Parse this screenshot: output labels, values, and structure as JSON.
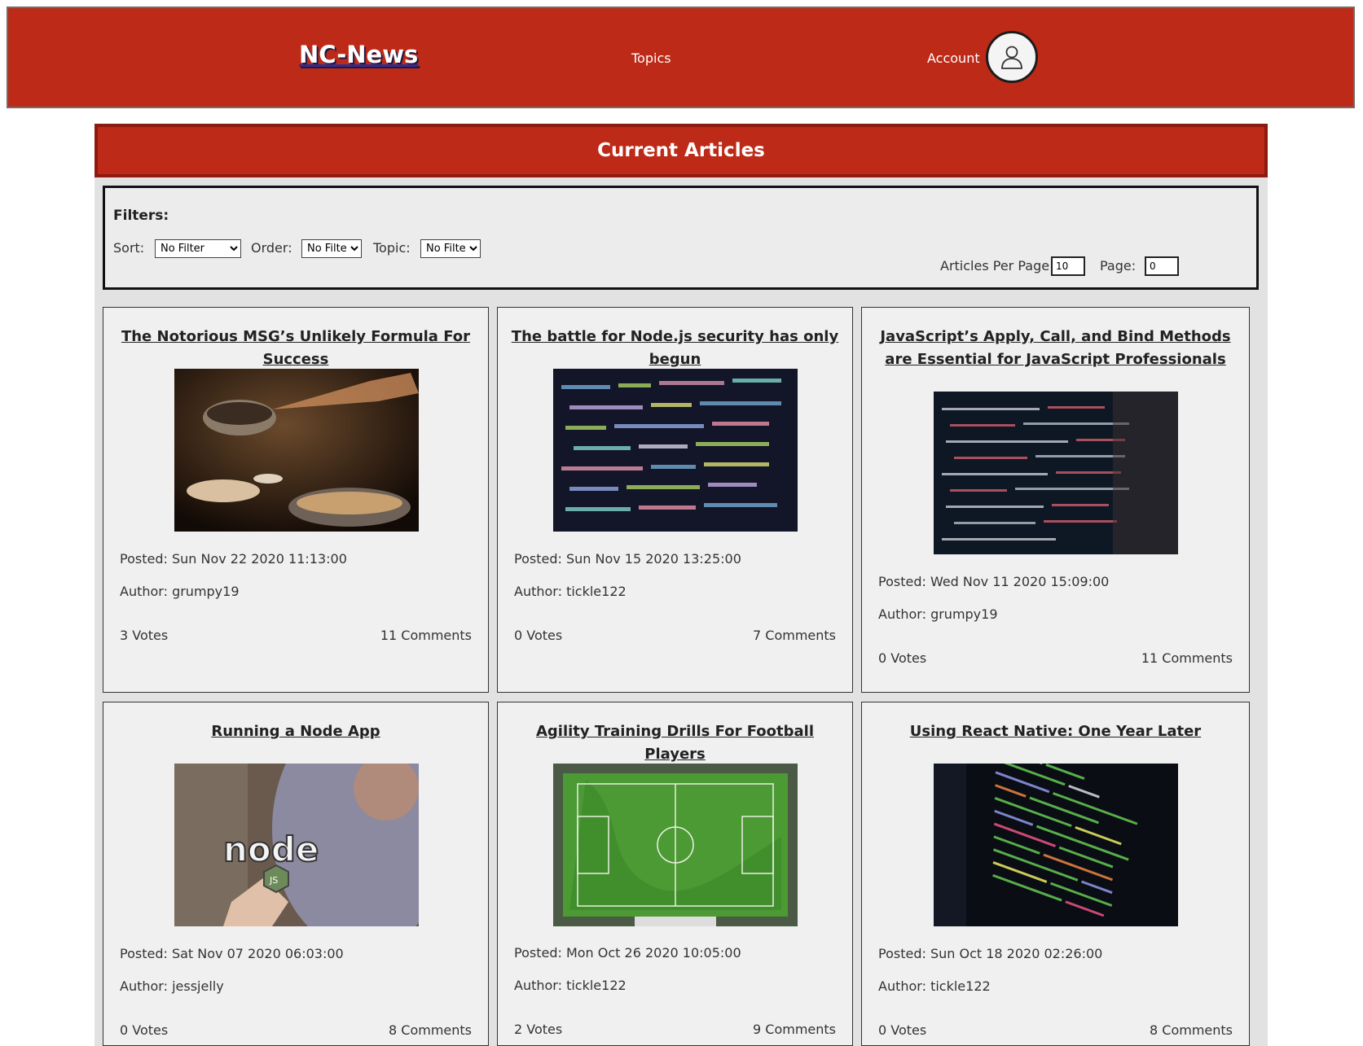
{
  "header": {
    "logo": "NC-News",
    "nav_topics": "Topics",
    "nav_account": "Account"
  },
  "main": {
    "title": "Current Articles"
  },
  "filters": {
    "heading": "Filters:",
    "sort_label": "Sort:",
    "sort_value": "No Filter",
    "order_label": "Order:",
    "order_value": "No Filter",
    "topic_label": "Topic:",
    "topic_value": "No Filter",
    "per_page_label": "Articles Per Page:",
    "per_page_value": "10",
    "page_label": "Page:",
    "page_value": "0"
  },
  "articles": [
    {
      "title": "The Notorious MSG’s Unlikely Formula For Success",
      "posted": "Posted: Sun Nov 22 2020 11:13:00",
      "author": "Author: grumpy19",
      "votes": "3 Votes",
      "comments": "11 Comments",
      "image": "cooking-photo"
    },
    {
      "title": "The battle for Node.js security has only begun",
      "posted": "Posted: Sun Nov 15 2020 13:25:00",
      "author": "Author: tickle122",
      "votes": "0 Votes",
      "comments": "7 Comments",
      "image": "code-screen-photo"
    },
    {
      "title": "JavaScript’s Apply, Call, and Bind Methods are Essential for JavaScript Professionals",
      "posted": "Posted: Wed Nov 11 2020 15:09:00",
      "author": "Author: grumpy19",
      "votes": "0 Votes",
      "comments": "11 Comments",
      "image": "code-monitor-photo"
    },
    {
      "title": "Running a Node App",
      "posted": "Posted: Sat Nov 07 2020 06:03:00",
      "author": "Author: jessjelly",
      "votes": "0 Votes",
      "comments": "8 Comments",
      "image": "node-sticker-photo"
    },
    {
      "title": "Agility Training Drills For Football Players",
      "posted": "Posted: Mon Oct 26 2020 10:05:00",
      "author": "Author: tickle122",
      "votes": "2 Votes",
      "comments": "9 Comments",
      "image": "football-pitch-photo"
    },
    {
      "title": "Using React Native: One Year Later",
      "posted": "Posted: Sun Oct 18 2020 02:26:00",
      "author": "Author: tickle122",
      "votes": "0 Votes",
      "comments": "8 Comments",
      "image": "code-laptop-photo"
    }
  ]
}
